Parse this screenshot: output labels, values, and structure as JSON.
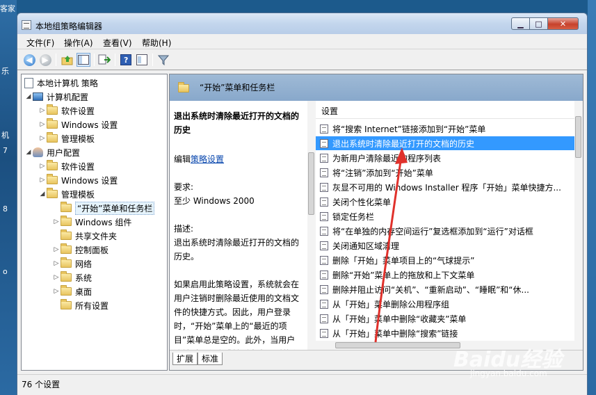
{
  "desktop": {
    "left_fragments": [
      "客家",
      "乐",
      "机",
      "7",
      "8",
      "o"
    ]
  },
  "window": {
    "title": "本地组策略编辑器"
  },
  "menu": {
    "items": [
      "文件(F)",
      "操作(A)",
      "查看(V)",
      "帮助(H)"
    ]
  },
  "toolbar": {
    "icons": [
      "back-icon",
      "forward-icon",
      "up-folder-icon",
      "show-tree-icon",
      "export-list-icon",
      "help-icon",
      "properties-icon",
      "filter-icon"
    ]
  },
  "tree": {
    "root": "本地计算机 策略",
    "computer_config": "计算机配置",
    "cc_software": "软件设置",
    "cc_windows": "Windows 设置",
    "cc_admin": "管理模板",
    "user_config": "用户配置",
    "uc_software": "软件设置",
    "uc_windows": "Windows 设置",
    "uc_admin": "管理模板",
    "start_menu": "“开始”菜单和任务栏",
    "windows_components": "Windows 组件",
    "shared_folders": "共享文件夹",
    "control_panel": "控制面板",
    "network": "网络",
    "system": "系统",
    "desktop": "桌面",
    "all_settings": "所有设置"
  },
  "pane_header": "“开始”菜单和任务栏",
  "description": {
    "title": "退出系统时清除最近打开的文档的历史",
    "edit_prefix": "编辑",
    "edit_link": "策略设置",
    "requirements_label": "要求:",
    "requirements": "至少 Windows 2000",
    "desc_label": "描述:",
    "desc_text": "退出系统时清除最近打开的文档的历史。",
    "detail": "如果启用此策略设置，系统就会在用户注销时删除最近使用的文档文件的快捷方式。因此，用户登录时，“开始”菜单上的“最近的项目”菜单总是空的。此外，当用户注销时，程序跳转列表中最近的和常用的项目将从“开始”菜单和任"
  },
  "settings": {
    "column_header": "设置",
    "rows": [
      "将“搜索 Internet”链接添加到“开始”菜单",
      "退出系统时清除最近打开的文档的历史",
      "为新用户清除最近的程序列表",
      "将“注销”添加到“开始”菜单",
      "灰显不可用的 Windows Installer 程序「开始」菜单快捷方...",
      "关闭个性化菜单",
      "锁定任务栏",
      "将“在单独的内存空间运行”复选框添加到“运行”对话框",
      "关闭通知区域清理",
      "删除「开始」菜单项目上的“气球提示”",
      "删除“开始”菜单上的拖放和上下文菜单",
      "删除并阻止访问“关机”、“重新启动”、“睡眠”和“休...",
      "从「开始」菜单删除公用程序组",
      "从「开始」菜单中删除“收藏夹”菜单",
      "从「开始」菜单中删除“搜索”链接"
    ],
    "selected_index": 1
  },
  "tabs": [
    "扩展",
    "标准"
  ],
  "status": "76 个设置",
  "watermark": {
    "logo": "Baidu经验",
    "url": "jingyan.baidu.com"
  },
  "colors": {
    "selection": "#3399ff",
    "header_band": "#9fbad6",
    "annotation_arrow": "#e0312b"
  }
}
